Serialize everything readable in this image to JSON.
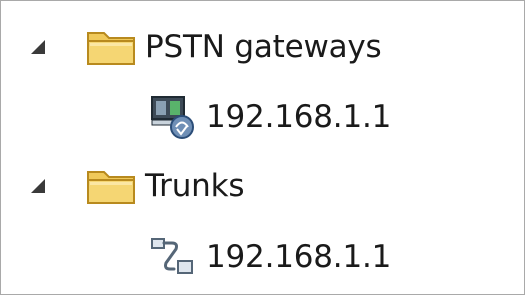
{
  "tree": {
    "groups": [
      {
        "label": "PSTN gateways",
        "expanded": true,
        "icon": "folder-icon",
        "children": [
          {
            "label": "192.168.1.1",
            "icon": "gateway-icon"
          }
        ]
      },
      {
        "label": "Trunks",
        "expanded": true,
        "icon": "folder-icon",
        "children": [
          {
            "label": "192.168.1.1",
            "icon": "trunk-icon"
          }
        ]
      }
    ]
  },
  "colors": {
    "border": "#a9a9a9",
    "text": "#1a1a1a",
    "folder_fill": "#f0c95a",
    "folder_edge": "#b88a1e",
    "expander": "#3a3a3a"
  }
}
